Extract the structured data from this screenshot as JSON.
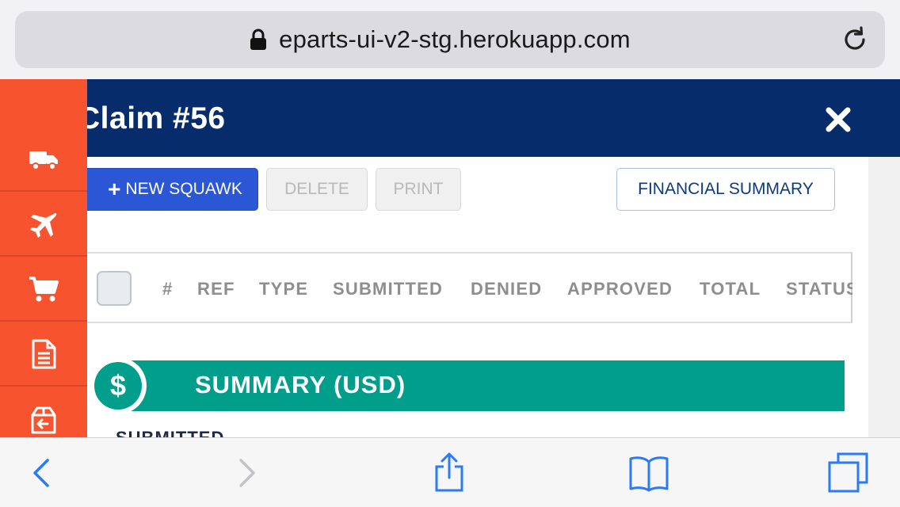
{
  "browser": {
    "url": "eparts-ui-v2-stg.herokuapp.com",
    "lock_icon": "lock-icon",
    "reload_icon": "reload-icon"
  },
  "modal": {
    "title": "Claim #56",
    "close_icon": "close-icon",
    "buttons": {
      "new_squawk": "NEW SQUAWK",
      "delete": "DELETE",
      "print": "PRINT",
      "financial_summary": "FINANCIAL SUMMARY"
    },
    "table_headers": [
      "#",
      "REF",
      "TYPE",
      "SUBMITTED",
      "DENIED",
      "APPROVED",
      "TOTAL",
      "STATUS"
    ],
    "summary": {
      "title": "SUMMARY (USD)",
      "icon": "$",
      "first_label": "SUBMITTED"
    }
  },
  "sidebar": {
    "items": [
      "truck-icon",
      "plane-icon",
      "cart-icon",
      "document-icon",
      "return-box-icon"
    ],
    "color": "#f6532e"
  },
  "colors": {
    "header": "#062c6b",
    "primary_button": "#2b56d6",
    "summary_bar": "#019e8c"
  },
  "toolbar": {
    "items": [
      "back-icon",
      "forward-icon",
      "share-icon",
      "bookmarks-icon",
      "tabs-icon"
    ]
  }
}
